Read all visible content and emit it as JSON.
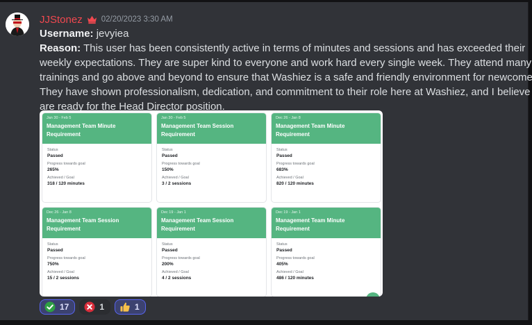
{
  "message": {
    "author": "JJStonez",
    "timestamp": "02/20/2023 3:30 AM",
    "username_label": "Username:",
    "username_value": "jevyiea",
    "reason_label": "Reason:",
    "reason_lines": [
      "This user has been consistently active in terms of minutes and sessions and has exceeded their",
      "weekly expectations. They are super kind to everyone and work hard every single week. They attend many",
      "trainings and go above and beyond to ensure that Washiez is a safe and friendly environment for newcomers.",
      "They have shown professionalism, dedication, and commitment to their role here at Washiez, and I believe they",
      "are ready for the Head Director position."
    ]
  },
  "embed": {
    "cards": [
      {
        "date": "Jan 30 - Feb 5",
        "title_1": "Management Team Minute",
        "title_2": "Requirement",
        "status_label": "Status",
        "status": "Passed",
        "progress_label": "Progress towards goal",
        "progress": "265%",
        "goal_label": "Achieved / Goal",
        "goal": "318 / 120 minutes"
      },
      {
        "date": "Jan 30 - Feb 5",
        "title_1": "Management Team Session",
        "title_2": "Requirement",
        "status_label": "Status",
        "status": "Passed",
        "progress_label": "Progress towards goal",
        "progress": "150%",
        "goal_label": "Achieved / Goal",
        "goal": "3 / 2 sessions"
      },
      {
        "date": "Dec 26 - Jan 8",
        "title_1": "Management Team Minute",
        "title_2": "Requirement",
        "status_label": "Status",
        "status": "Passed",
        "progress_label": "Progress towards goal",
        "progress": "683%",
        "goal_label": "Achieved / Goal",
        "goal": "820 / 120 minutes"
      },
      {
        "date": "Dec 26 - Jan 8",
        "title_1": "Management Team Session",
        "title_2": "Requirement",
        "status_label": "Status",
        "status": "Passed",
        "progress_label": "Progress towards goal",
        "progress": "750%",
        "goal_label": "Achieved / Goal",
        "goal": "15 / 2 sessions"
      },
      {
        "date": "Dec 19 - Jan 1",
        "title_1": "Management Team Session",
        "title_2": "Requirement",
        "status_label": "Status",
        "status": "Passed",
        "progress_label": "Progress towards goal",
        "progress": "200%",
        "goal_label": "Achieved / Goal",
        "goal": "4 / 2 sessions"
      },
      {
        "date": "Dec 19 - Jan 1",
        "title_1": "Management Team Minute",
        "title_2": "Requirement",
        "status_label": "Status",
        "status": "Passed",
        "progress_label": "Progress towards goal",
        "progress": "405%",
        "goal_label": "Achieved / Goal",
        "goal": "486 / 120 minutes"
      }
    ]
  },
  "reactions": [
    {
      "icon": "check-icon",
      "count": "17",
      "active": true
    },
    {
      "icon": "cross-icon",
      "count": "1",
      "active": false
    },
    {
      "icon": "thumbs-up-icon",
      "count": "1",
      "active": true
    }
  ],
  "colors": {
    "background": "#313338",
    "author": "#f0484f",
    "card_header": "#55b581",
    "reaction_active": "#3c4270"
  }
}
